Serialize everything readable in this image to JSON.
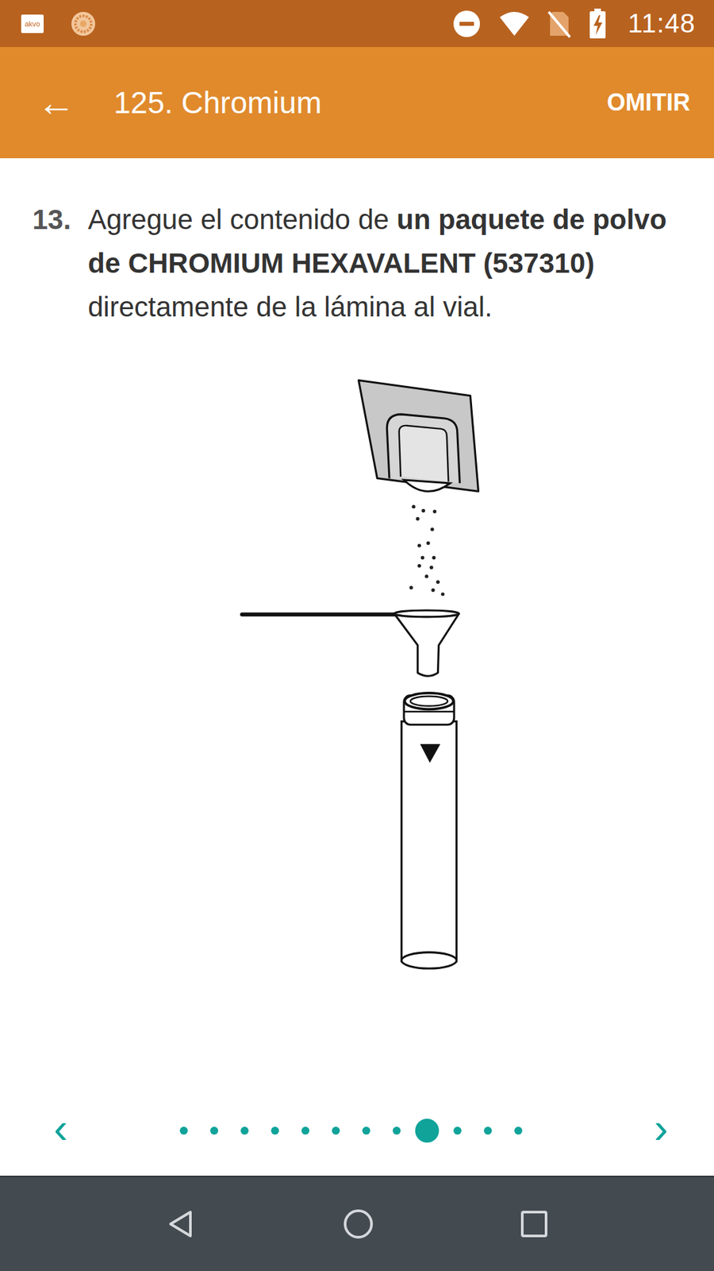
{
  "status_bar": {
    "logo": "akvo",
    "time": "11:48"
  },
  "app_bar": {
    "back": "←",
    "title": "125. Chromium",
    "action": "OMITIR"
  },
  "step": {
    "number": "13.",
    "segments": [
      {
        "text": "Agregue el contenido de ",
        "bold": false
      },
      {
        "text": "un paquete de polvo de CHROMIUM HEXAVALENT (537310)",
        "bold": true
      },
      {
        "text": " directamente de la lámina al vial.",
        "bold": false
      }
    ]
  },
  "pager": {
    "prev": "‹",
    "next": "›",
    "dots": [
      {
        "selected": false
      },
      {
        "selected": false
      },
      {
        "selected": false
      },
      {
        "selected": false
      },
      {
        "selected": false
      },
      {
        "selected": false
      },
      {
        "selected": false
      },
      {
        "selected": false
      },
      {
        "selected": true
      },
      {
        "selected": false
      },
      {
        "selected": false
      },
      {
        "selected": false
      }
    ]
  }
}
